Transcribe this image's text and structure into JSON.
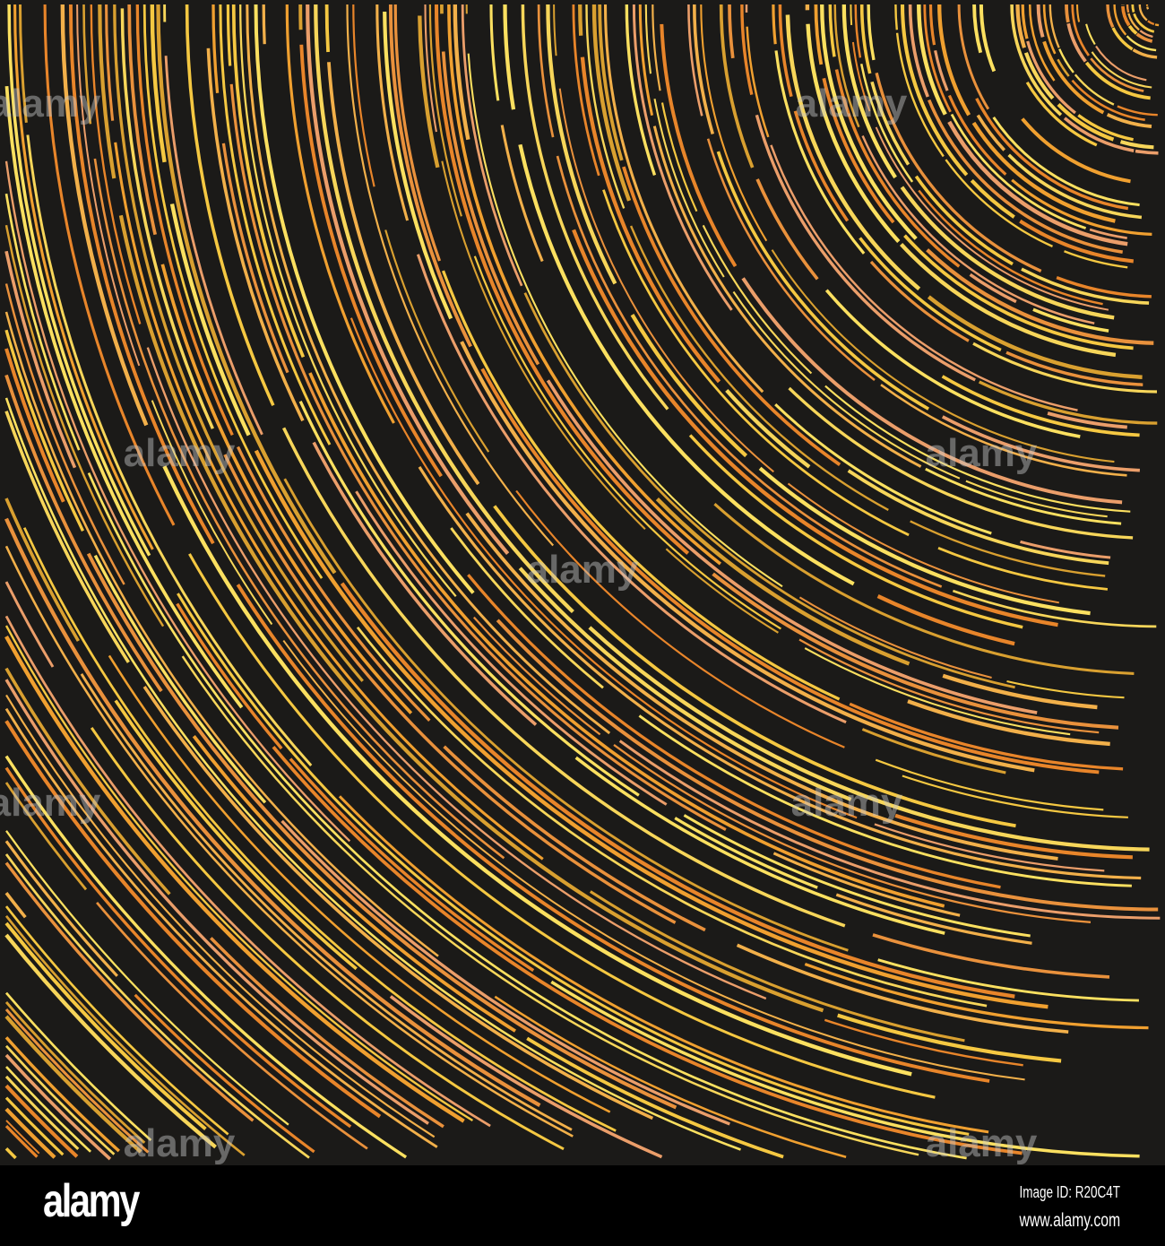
{
  "artwork": {
    "background_color": "#1b1a18",
    "palette": [
      "#f5c842",
      "#f0a030",
      "#e8852a",
      "#f7d65a",
      "#e9913c",
      "#f2b04a",
      "#eb9e6a",
      "#d9a030",
      "#fbe060"
    ],
    "watermark_text": "alamy"
  },
  "footer": {
    "logo": "alamy",
    "image_id": "Image ID: R20C4T",
    "website": "www.alamy.com"
  }
}
